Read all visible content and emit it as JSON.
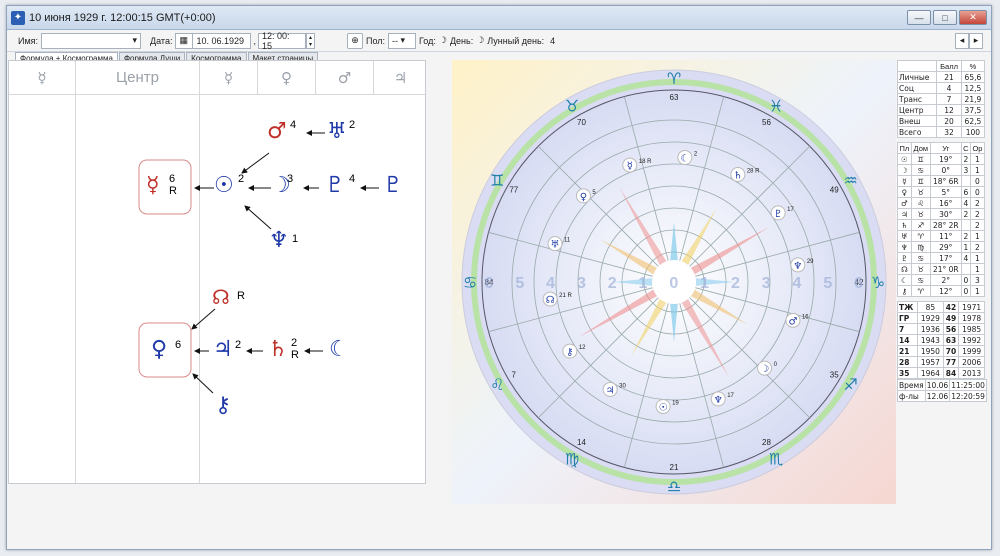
{
  "window": {
    "title": "10 июня 1929 г. 12:00:15 GMT(+0:00)",
    "icon": "astro-app-icon"
  },
  "toolbar": {
    "name_label": "Имя:",
    "date_label": "Дата:",
    "date_value": "10. 06.1929",
    "time_value": "12: 00: 15",
    "sex_label": "Пол:",
    "sex_value": "--",
    "year_label": "Год:",
    "day_label": "День:",
    "lunar_day_label": "Лунный день:",
    "lunar_day_value": "4",
    "year_symbol": "☽",
    "day_symbol": "☽"
  },
  "tabs": [
    "Формула + Космограмма",
    "Формула Души",
    "Космограмма",
    "Макет страницы"
  ],
  "formula": {
    "header": [
      "☿",
      "Центр",
      "☿",
      "♀",
      "♂",
      "♃"
    ],
    "nodes": {
      "mercury": {
        "glyph": "☿",
        "num": "6",
        "sub": "R"
      },
      "sun": {
        "glyph": "☉",
        "num": "2"
      },
      "moon": {
        "glyph": "☽",
        "num": "3"
      },
      "mars": {
        "glyph": "♂",
        "num": "4"
      },
      "uranus": {
        "glyph": "♅",
        "num": "2"
      },
      "pluto": {
        "glyph": "♇",
        "num": "4"
      },
      "pluto2": {
        "glyph": "♇"
      },
      "neptune": {
        "glyph": "♆",
        "num": "1"
      },
      "node": {
        "glyph": "☊",
        "sub": "R"
      },
      "venus": {
        "glyph": "♀",
        "num": "6"
      },
      "jupiter": {
        "glyph": "♃",
        "num": "2"
      },
      "saturn": {
        "glyph": "♄",
        "num": "2",
        "sub": "R"
      },
      "lilith": {
        "glyph": "☾"
      },
      "chiron": {
        "glyph": "⚷"
      }
    }
  },
  "chart": {
    "signs": [
      "♓",
      "♒",
      "♑",
      "♐",
      "♏",
      "♎",
      "♍",
      "♌",
      "♋",
      "♊",
      "♉",
      "♈"
    ],
    "degree_labels": [
      "63",
      "56",
      "49",
      "42",
      "35",
      "28",
      "21",
      "14",
      "7",
      "84",
      "77",
      "70"
    ],
    "score_labels": [
      "6",
      "5",
      "4",
      "3",
      "2",
      "1",
      "0",
      "1",
      "2",
      "3",
      "4",
      "5",
      "6"
    ],
    "planets": [
      {
        "glyph": "☾",
        "label": "2"
      },
      {
        "glyph": "♄",
        "label": "28 R"
      },
      {
        "glyph": "♇",
        "label": "17"
      },
      {
        "glyph": "♆",
        "label": "29"
      },
      {
        "glyph": "♂",
        "label": "16"
      },
      {
        "glyph": "☽",
        "label": "0"
      },
      {
        "glyph": "♆",
        "label": "17"
      },
      {
        "glyph": "☉",
        "label": "19"
      },
      {
        "glyph": "♃",
        "label": "30"
      },
      {
        "glyph": "⚷",
        "label": "12"
      },
      {
        "glyph": "☊",
        "label": "21 R"
      },
      {
        "glyph": "♅",
        "label": "11"
      },
      {
        "glyph": "♀",
        "label": "5"
      },
      {
        "glyph": "☿",
        "label": "18 R"
      }
    ]
  },
  "scores": {
    "headers": [
      "",
      "Балл",
      "%"
    ],
    "rows": [
      [
        "Личные",
        "21",
        "65,6"
      ],
      [
        "Соц",
        "4",
        "12,5"
      ],
      [
        "Транс",
        "7",
        "21,9"
      ],
      [
        "Центр",
        "12",
        "37,5"
      ],
      [
        "Внеш",
        "20",
        "62,5"
      ],
      [
        "Всего",
        "32",
        "100"
      ]
    ]
  },
  "planet_table": {
    "headers": [
      "Пл",
      "Дом",
      "Уг",
      "С",
      "Ор"
    ],
    "rows": [
      [
        "☉",
        "♊",
        "19°",
        "2",
        "1"
      ],
      [
        "☽",
        "♋",
        "0°",
        "3",
        "1"
      ],
      [
        "☿",
        "♊",
        "18° 6R",
        "",
        "0"
      ],
      [
        "♀",
        "♉",
        "5°",
        "6",
        "0"
      ],
      [
        "♂",
        "♌",
        "16°",
        "4",
        "2"
      ],
      [
        "♃",
        "♉",
        "30°",
        "2",
        "2"
      ],
      [
        "♄",
        "♐",
        "28° 2R",
        "",
        "2"
      ],
      [
        "♅",
        "♈",
        "11°",
        "2",
        "1"
      ],
      [
        "♆",
        "♍",
        "29°",
        "1",
        "2"
      ],
      [
        "♇",
        "♋",
        "17°",
        "4",
        "1"
      ],
      [
        "☊",
        "♉",
        "21° 0R",
        "",
        "1"
      ],
      [
        "☾",
        "♋",
        "2°",
        "0",
        "3"
      ],
      [
        "⚷",
        "♈",
        "12°",
        "0",
        "1"
      ]
    ]
  },
  "cycles": {
    "rows": [
      [
        "ТЖ",
        "85",
        "42",
        "1971"
      ],
      [
        "ГР",
        "1929",
        "49",
        "1978"
      ],
      [
        "7",
        "1936",
        "56",
        "1985"
      ],
      [
        "14",
        "1943",
        "63",
        "1992"
      ],
      [
        "21",
        "1950",
        "70",
        "1999"
      ],
      [
        "28",
        "1957",
        "77",
        "2006"
      ],
      [
        "35",
        "1964",
        "84",
        "2013"
      ]
    ]
  },
  "times": {
    "rows": [
      [
        "Время",
        "10.06",
        "11:25:00"
      ],
      [
        "ф-лы",
        "12.06",
        "12:20:59"
      ]
    ]
  }
}
